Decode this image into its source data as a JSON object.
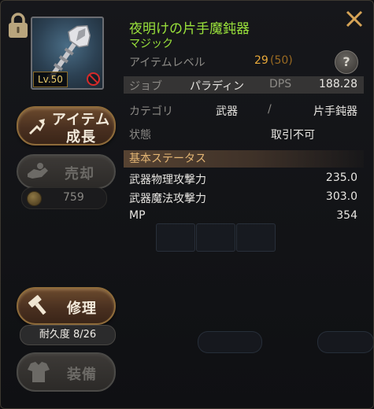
{
  "item": {
    "name": "夜明けの片手魔鈍器",
    "grade": "マジック",
    "level_tag": "Lv.50"
  },
  "info": {
    "item_level_label": "アイテムレベル",
    "item_level_value": "29",
    "item_level_max": "(50)",
    "job_label": "ジョブ",
    "job_value": "パラディン",
    "dps_label": "DPS",
    "dps_value": "188.28",
    "category_label": "カテゴリ",
    "category_value": "武器",
    "category_sep": "/",
    "category_sub": "片手鈍器",
    "state_label": "状態",
    "state_value": "取引不可"
  },
  "help_label": "?",
  "stats": {
    "header": "基本ステータス",
    "rows": [
      {
        "label": "武器物理攻撃力",
        "value": "235.0"
      },
      {
        "label": "武器魔法攻撃力",
        "value": "303.0"
      },
      {
        "label": "MP",
        "value": "354"
      }
    ]
  },
  "buttons": {
    "grow_line1": "アイテム",
    "grow_line2": "成長",
    "sell": "売却",
    "repair": "修理",
    "equip": "装備"
  },
  "price": "759",
  "durability": "耐久度 8/26",
  "colors": {
    "item_name": "#9ae23b",
    "item_level": "#e8a93a",
    "section_header": "#e3b574",
    "lock": "#b9a57d",
    "close": "#d6a456"
  },
  "icons": [
    "lock-icon",
    "close-icon",
    "help-icon",
    "level-up-icon",
    "sell-icon",
    "coin-icon",
    "hammer-icon",
    "equip-icon",
    "no-trade-icon"
  ]
}
